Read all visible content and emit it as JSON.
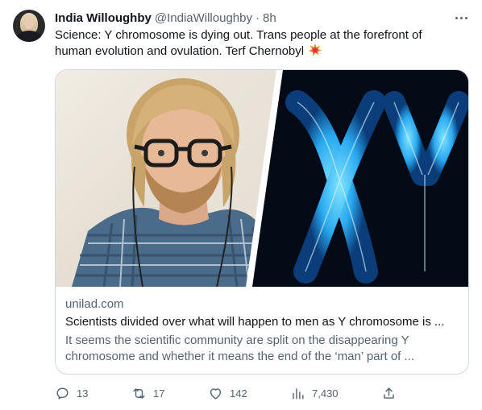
{
  "tweet": {
    "display_name": "India Willoughby",
    "handle": "@IndiaWilloughby",
    "separator": "·",
    "time": "8h",
    "text": "Science: Y chromosome is dying out. Trans people at the forefront of human evolution and ovulation. Terf Chernobyl",
    "emoji": "collision-icon"
  },
  "card": {
    "domain": "unilad.com",
    "title": "Scientists divided over what will happen to men as Y chromosome is ...",
    "description": "It seems the scientific community are split on the disappearing Y chromosome and whether it means the end of the ‘man’ part of ..."
  },
  "actions": {
    "replies": "13",
    "retweets": "17",
    "likes": "142",
    "views": "7,430"
  },
  "colors": {
    "text_primary": "#0f1419",
    "text_secondary": "#536471",
    "border": "#cfd9de",
    "chromosome_blue": "#35c3ff"
  }
}
